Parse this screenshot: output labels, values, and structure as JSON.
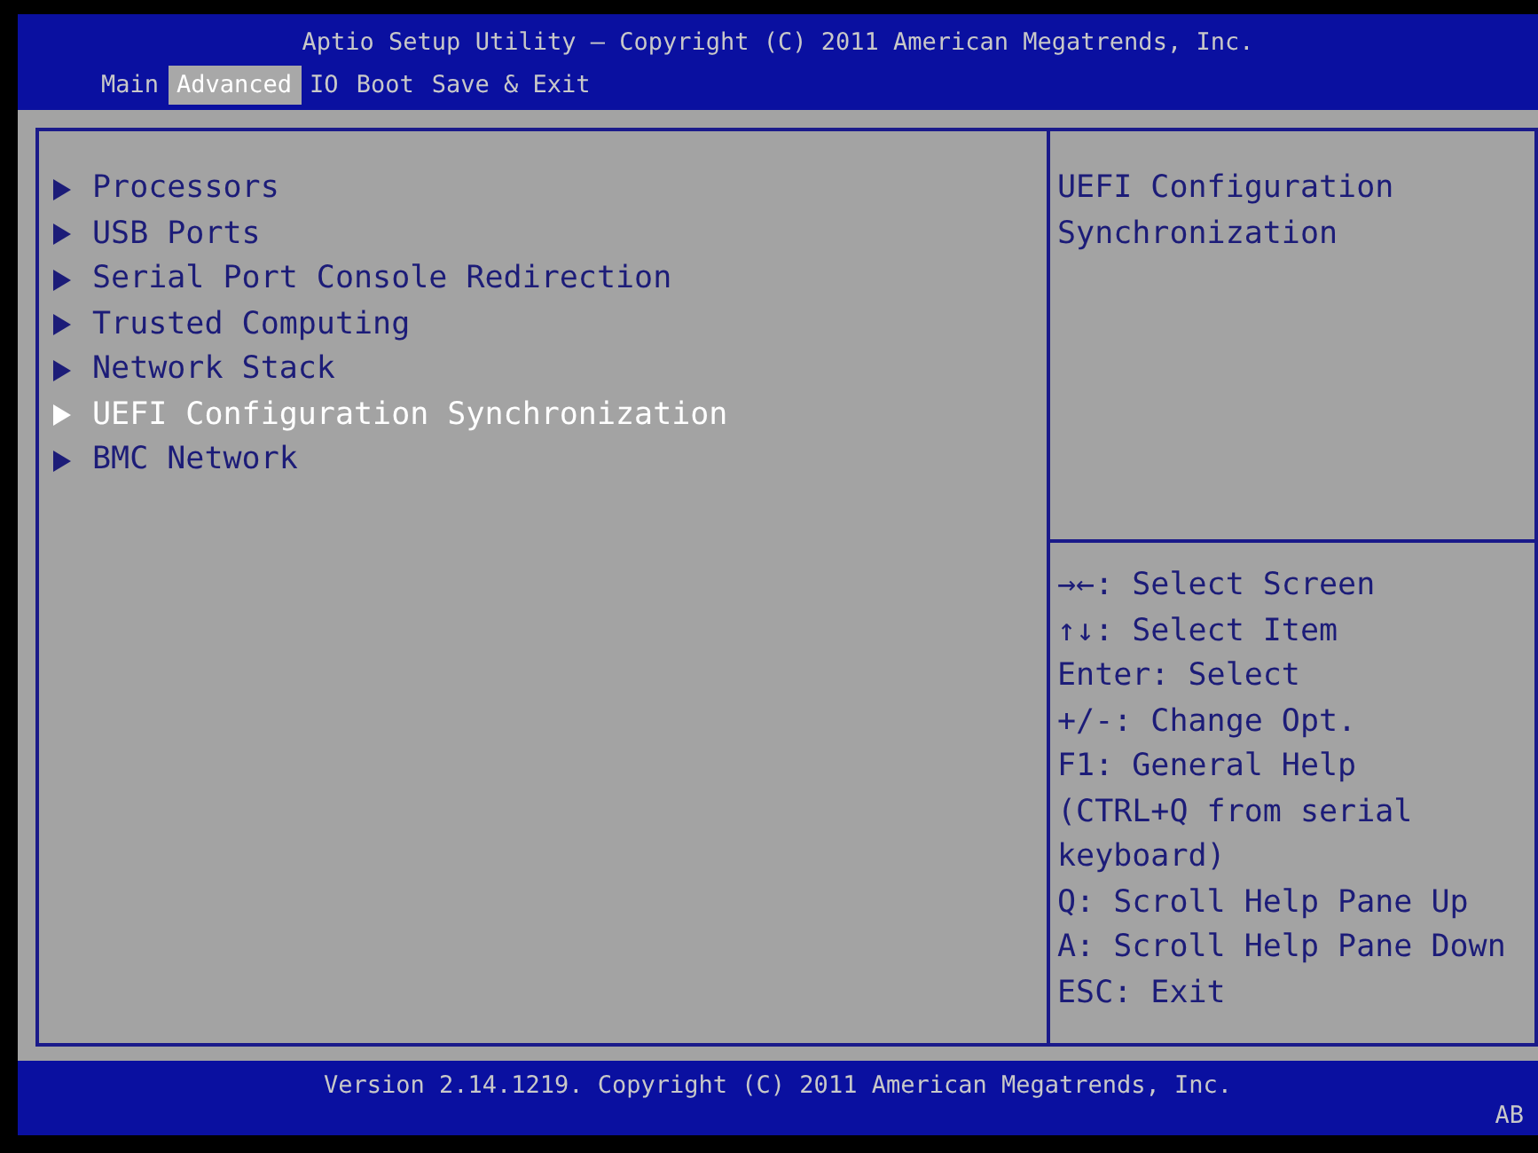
{
  "window": {
    "title": "Aptio Setup Utility – Copyright (C) 2011 American Megatrends, Inc."
  },
  "tabs": [
    {
      "label": "Main",
      "selected": false
    },
    {
      "label": "Advanced",
      "selected": true
    },
    {
      "label": "IO",
      "selected": false
    },
    {
      "label": "Boot",
      "selected": false
    },
    {
      "label": "Save & Exit",
      "selected": false
    }
  ],
  "menu_items": [
    {
      "label": "Processors",
      "selected": false
    },
    {
      "label": "USB Ports",
      "selected": false
    },
    {
      "label": "Serial Port Console Redirection",
      "selected": false
    },
    {
      "label": "Trusted Computing",
      "selected": false
    },
    {
      "label": "Network Stack",
      "selected": false
    },
    {
      "label": "UEFI Configuration Synchronization",
      "selected": true
    },
    {
      "label": "BMC Network",
      "selected": false
    }
  ],
  "help_text": [
    "UEFI Configuration",
    "Synchronization"
  ],
  "key_help": [
    "→←: Select Screen",
    "↑↓: Select Item",
    "Enter: Select",
    "+/-: Change Opt.",
    "F1: General Help",
    "(CTRL+Q from serial",
    "keyboard)",
    "Q: Scroll Help Pane Up",
    "A: Scroll Help Pane Down",
    "ESC: Exit"
  ],
  "status_bar": {
    "version": "Version 2.14.1219. Copyright (C) 2011 American Megatrends, Inc.",
    "code": "AB"
  }
}
